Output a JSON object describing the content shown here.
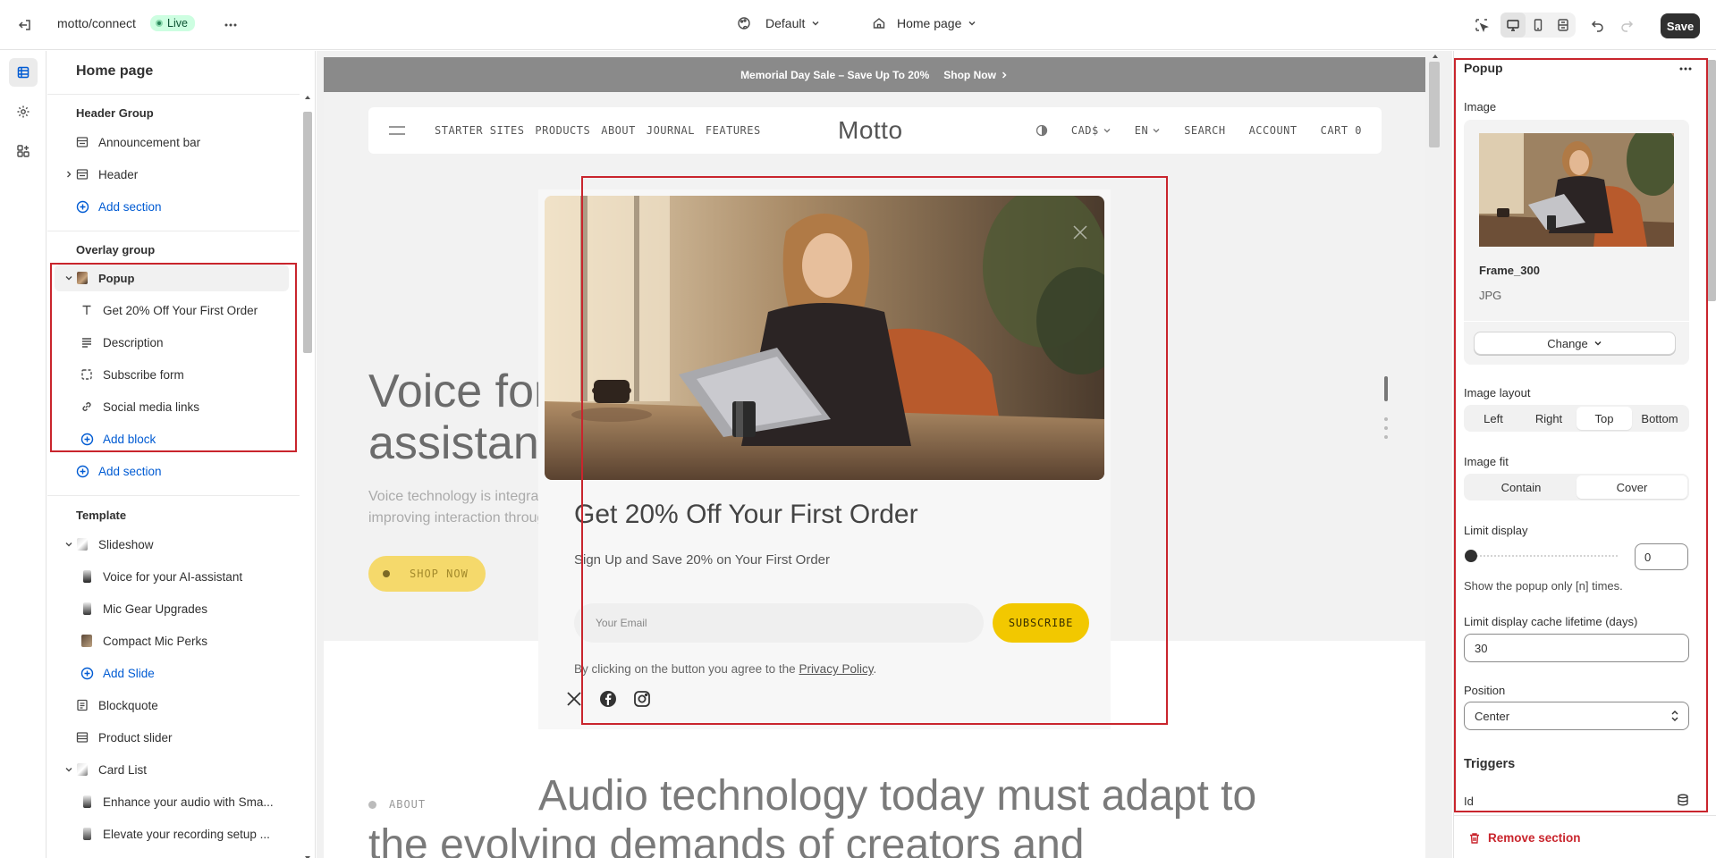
{
  "topbar": {
    "store": "motto/connect",
    "status": "Live",
    "theme_select": "Default",
    "page_select": "Home page",
    "save_label": "Save"
  },
  "left_panel": {
    "title": "Home page",
    "header_group": {
      "title": "Header Group",
      "items": [
        "Announcement bar",
        "Header"
      ],
      "add": "Add section"
    },
    "overlay_group": {
      "title": "Overlay group",
      "section": "Popup",
      "blocks": [
        "Get 20% Off Your First Order",
        "Description",
        "Subscribe form",
        "Social media links"
      ],
      "add_block": "Add block",
      "add": "Add section"
    },
    "template": {
      "title": "Template",
      "slideshow": "Slideshow",
      "slides": [
        "Voice for your AI-assistant",
        "Mic Gear Upgrades",
        "Compact Mic Perks"
      ],
      "add_slide": "Add Slide",
      "sections": [
        "Blockquote",
        "Product slider"
      ],
      "card_list": "Card List",
      "cards": [
        "Enhance your audio with Sma...",
        "Elevate your recording setup ..."
      ]
    }
  },
  "preview": {
    "announcement": "Memorial Day Sale – Save Up To 20%",
    "announcement_link": "Shop Now",
    "nav_links": [
      "STARTER SITES",
      "PRODUCTS",
      "ABOUT",
      "JOURNAL",
      "FEATURES"
    ],
    "logo": "Motto",
    "currency": "CAD$",
    "language": "EN",
    "nav_right": [
      "SEARCH",
      "ACCOUNT",
      "CART 0"
    ],
    "hero_title_1": "Voice for y",
    "hero_title_2": "assistant",
    "hero_desc_1": "Voice technology is integrated int",
    "hero_desc_2": "improving interaction through con",
    "hero_cta": "SHOP NOW",
    "about_label": "ABOUT",
    "about_text_1": "Audio technology today must adapt to",
    "about_text_2": "the evolving demands of creators and"
  },
  "popup": {
    "title": "Get 20% Off Your First Order",
    "subtitle": "Sign Up and Save 20% on Your First Order",
    "email_placeholder": "Your Email",
    "subscribe": "SUBSCRIBE",
    "agree_prefix": "By clicking on the button you agree to the",
    "privacy": "Privacy Policy",
    "agree_suffix": "."
  },
  "right_panel": {
    "title": "Popup",
    "image_label": "Image",
    "file_name": "Frame_300",
    "file_type": "JPG",
    "change": "Change",
    "image_layout_label": "Image layout",
    "image_layout_options": [
      "Left",
      "Right",
      "Top",
      "Bottom"
    ],
    "image_layout_selected": "Top",
    "image_fit_label": "Image fit",
    "image_fit_options": [
      "Contain",
      "Cover"
    ],
    "image_fit_selected": "Cover",
    "limit_display_label": "Limit display",
    "limit_display_value": "0",
    "limit_display_help": "Show the popup only [n] times.",
    "cache_label": "Limit display cache lifetime (days)",
    "cache_value": "30",
    "position_label": "Position",
    "position_value": "Center",
    "triggers_label": "Triggers",
    "id_label": "Id",
    "remove": "Remove section"
  },
  "colors": {
    "accent_blue": "#005bd3",
    "annotation_red": "#c9252d",
    "live_green": "#cdfee1",
    "subscribe_yellow": "#f2c800"
  }
}
